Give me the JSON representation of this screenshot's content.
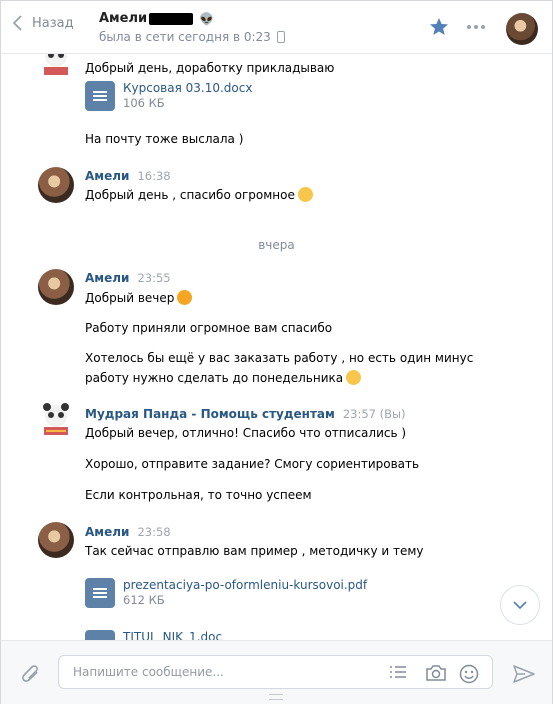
{
  "header": {
    "back_label": "Назад",
    "contact_name": "Амели",
    "status": "была в сети сегодня в 0:23"
  },
  "messages": {
    "m1_text": "Добрый день, доработку прикладываю",
    "doc1": {
      "name": "Курсовая 03.10.docx",
      "size": "106 КБ"
    },
    "m2_text": "На почту тоже выслала )",
    "a1": {
      "author": "Амели",
      "time": "16:38"
    },
    "a1_text": "Добрый день , спасибо огромное",
    "date_separator": "вчера",
    "a2": {
      "author": "Амели",
      "time": "23:55"
    },
    "a2_text1": "Добрый вечер",
    "a2_text2": "Работу приняли огромное вам спасибо",
    "a2_text3": "Хотелось бы ещё у вас заказать работу , но есть один минус",
    "a2_text4": "работу нужно сделать до понедельника",
    "p1": {
      "author": "Мудрая Панда - Помощь студентам",
      "time": "23:57 (Вы)"
    },
    "p1_text1": "Добрый вечер, отлично! Спасибо что отписались )",
    "p1_text2": "Хорошо, отправите задание? Смогу сориентировать",
    "p1_text3": "Если контрольная, то точно успеем",
    "a3": {
      "author": "Амели",
      "time": "23:58"
    },
    "a3_text": "Так сейчас отправлю вам пример , методичку и тему",
    "doc2": {
      "name": "prezentaciya-po-oformleniu-kursovoi.pdf",
      "size": "612 КБ"
    },
    "doc3": {
      "name": "TITUL_NIK_1.doc"
    }
  },
  "composer": {
    "placeholder": "Напишите сообщение..."
  },
  "icons": [
    "back-chevron-icon",
    "alien-icon",
    "phone-icon",
    "star-icon",
    "more-icon",
    "document-icon",
    "smile-emoji",
    "paperclip-icon",
    "template-list-icon",
    "camera-icon",
    "emoji-icon",
    "send-icon",
    "chevron-down-icon"
  ],
  "colors": {
    "link": "#2a5885",
    "muted": "#828a99",
    "accent": "#5181b8",
    "doc": "#5e81a8"
  }
}
